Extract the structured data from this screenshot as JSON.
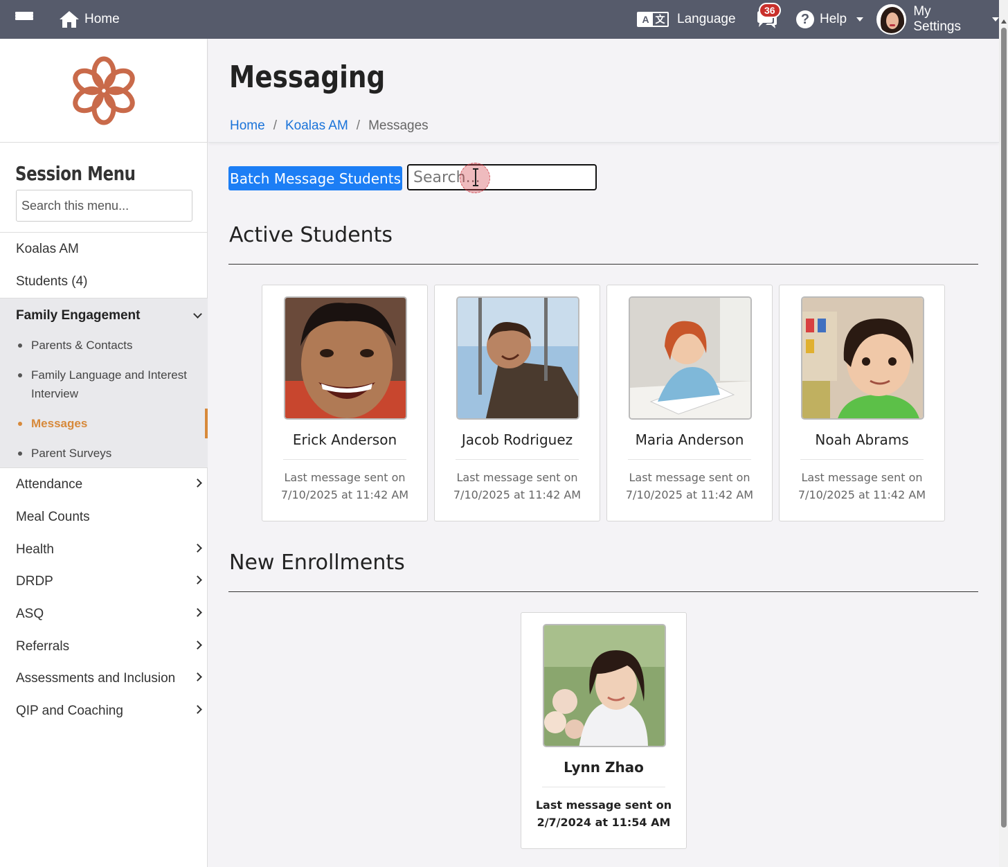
{
  "topbar": {
    "home_label": "Home",
    "language_label": "Language",
    "notification_count": "36",
    "help_label": "Help",
    "settings_label": "My Settings"
  },
  "sidebar": {
    "title": "Session Menu",
    "search_placeholder": "Search this menu...",
    "items": {
      "koalas": "Koalas AM",
      "students": "Students (4)",
      "family_engagement": "Family Engagement",
      "attendance": "Attendance",
      "meal_counts": "Meal Counts",
      "health": "Health",
      "drdp": "DRDP",
      "asq": "ASQ",
      "referrals": "Referrals",
      "assessments": "Assessments and Inclusion",
      "qip": "QIP and Coaching"
    },
    "family_sub": {
      "parents": "Parents & Contacts",
      "interview": "Family Language and Interest Interview",
      "messages": "Messages",
      "surveys": "Parent Surveys"
    }
  },
  "main": {
    "title": "Messaging",
    "breadcrumb": {
      "home": "Home",
      "class": "Koalas AM",
      "current": "Messages"
    },
    "batch_button": "Batch Message Students",
    "search_placeholder": "Search...",
    "active_title": "Active Students",
    "new_title": "New Enrollments",
    "last_sent_label": "Last message sent on",
    "active_students": [
      {
        "name": "Erick Anderson",
        "last_sent": "7/10/2025 at 11:42 AM"
      },
      {
        "name": "Jacob Rodriguez",
        "last_sent": "7/10/2025 at 11:42 AM"
      },
      {
        "name": "Maria Anderson",
        "last_sent": "7/10/2025 at 11:42 AM"
      },
      {
        "name": "Noah Abrams",
        "last_sent": "7/10/2025 at 11:42 AM"
      }
    ],
    "new_enrollments": [
      {
        "name": "Lynn Zhao",
        "last_sent": "2/7/2024 at 11:54 AM"
      }
    ]
  },
  "colors": {
    "topbar": "#565b6b",
    "accent_blue": "#1c7ef5",
    "active_menu": "#d7893a",
    "logo": "#c96a4a",
    "badge": "#c9302c"
  }
}
